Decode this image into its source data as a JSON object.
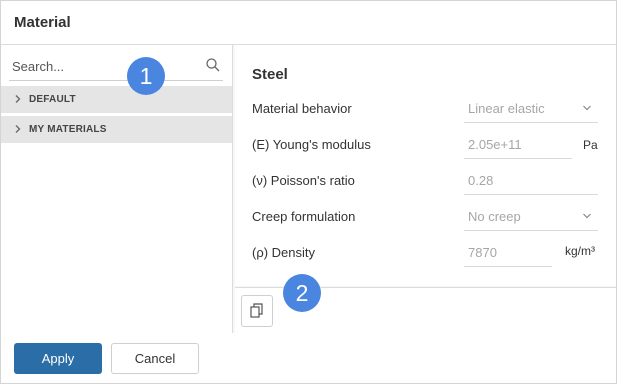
{
  "dialog": {
    "title": "Material"
  },
  "search": {
    "placeholder": "Search..."
  },
  "tree": {
    "items": [
      {
        "label": "DEFAULT"
      },
      {
        "label": "MY MATERIALS"
      }
    ]
  },
  "material": {
    "name": "Steel",
    "fields": {
      "behavior": {
        "label": "Material behavior",
        "value": "Linear elastic"
      },
      "youngs": {
        "label": "(E) Young's modulus",
        "value": "2.05e+11",
        "unit": "Pa"
      },
      "poisson": {
        "label": "(ν) Poisson's ratio",
        "value": "0.28"
      },
      "creep": {
        "label": "Creep formulation",
        "value": "No creep"
      },
      "density": {
        "label": "(ρ) Density",
        "value": "7870",
        "unit": "kg/m³"
      }
    }
  },
  "badges": {
    "one": "1",
    "two": "2"
  },
  "footer": {
    "apply_label": "Apply",
    "cancel_label": "Cancel"
  },
  "colors": {
    "accent": "#2b6ea7",
    "badge": "#4a86e0"
  },
  "icons": {
    "search": "search-icon",
    "copy": "copy-icon",
    "chevron_right": "chevron-right-icon",
    "chevron_down": "chevron-down-icon"
  }
}
